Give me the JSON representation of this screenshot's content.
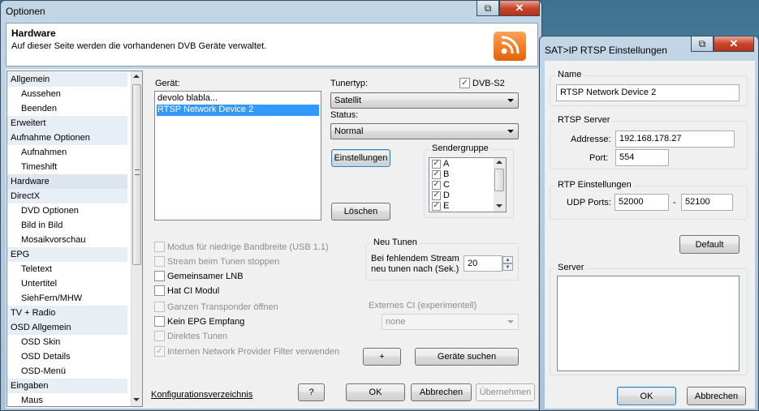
{
  "main_window": {
    "title": "Optionen",
    "header_title": "Hardware",
    "header_subtitle": "Auf dieser Seite werden die vorhandenen DVB Geräte verwaltet.",
    "accent_color": "#f47920"
  },
  "tree": [
    {
      "label": "Allgemein",
      "type": "cat"
    },
    {
      "label": "Aussehen",
      "type": "sub"
    },
    {
      "label": "Beenden",
      "type": "sub"
    },
    {
      "label": "Erweitert",
      "type": "cat"
    },
    {
      "label": "Aufnahme Optionen",
      "type": "cat"
    },
    {
      "label": "Aufnahmen",
      "type": "sub"
    },
    {
      "label": "Timeshift",
      "type": "sub"
    },
    {
      "label": "Hardware",
      "type": "cat",
      "selected": true
    },
    {
      "label": "DirectX",
      "type": "cat"
    },
    {
      "label": "DVD Optionen",
      "type": "sub"
    },
    {
      "label": "Bild in Bild",
      "type": "sub"
    },
    {
      "label": "Mosaikvorschau",
      "type": "sub"
    },
    {
      "label": "EPG",
      "type": "cat"
    },
    {
      "label": "Teletext",
      "type": "sub"
    },
    {
      "label": "Untertitel",
      "type": "sub"
    },
    {
      "label": "SiehFern/MHW",
      "type": "sub"
    },
    {
      "label": "TV + Radio",
      "type": "cat"
    },
    {
      "label": "OSD Allgemein",
      "type": "cat"
    },
    {
      "label": "OSD Skin",
      "type": "sub"
    },
    {
      "label": "OSD Details",
      "type": "sub"
    },
    {
      "label": "OSD-Menü",
      "type": "sub"
    },
    {
      "label": "Eingaben",
      "type": "cat"
    },
    {
      "label": "Maus",
      "type": "sub"
    }
  ],
  "hardware": {
    "device_label": "Gerät:",
    "devices": [
      "devolo blabla...",
      "RTSP Network Device 2"
    ],
    "selected_device": "RTSP Network Device 2",
    "tunertype_label": "Tunertyp:",
    "tunertype_value": "Satellit",
    "dvbs2_label": "DVB-S2",
    "dvbs2_checked": true,
    "status_label": "Status:",
    "status_value": "Normal",
    "einstellungen_btn": "Einstellungen",
    "loeschen_btn": "Löschen",
    "sendergruppe_label": "Sendergruppe",
    "sendergruppen": [
      "A",
      "B",
      "C",
      "D",
      "E"
    ],
    "options": [
      {
        "label": "Modus für niedrige Bandbreite (USB 1.1)",
        "checked": false,
        "enabled": false
      },
      {
        "label": "Stream beim Tunen stoppen",
        "checked": false,
        "enabled": false
      },
      {
        "label": "Gemeinsamer LNB",
        "checked": false,
        "enabled": true
      },
      {
        "label": "Hat CI Modul",
        "checked": false,
        "enabled": true
      },
      {
        "label": "Ganzen Transponder öffnen",
        "checked": false,
        "enabled": false
      },
      {
        "label": "Kein EPG Empfang",
        "checked": false,
        "enabled": true
      },
      {
        "label": "Direktes Tunen",
        "checked": false,
        "enabled": false
      },
      {
        "label": "Internen Network Provider Filter verwenden",
        "checked": true,
        "enabled": false
      }
    ],
    "neu_tunen_label": "Neu Tunen",
    "neu_tunen_text_1": "Bei fehlendem Stream",
    "neu_tunen_text_2": "neu tunen nach (Sek.)",
    "neu_tunen_value": "20",
    "externes_ci_label": "Externes CI (experimentell)",
    "externes_ci_value": "none",
    "plus_btn": "+",
    "geraete_suchen_btn": "Geräte suchen",
    "konfig_link": "Konfigurationsverzeichnis",
    "help_btn": "?",
    "ok_btn": "OK",
    "abbrechen_btn": "Abbrechen",
    "uebernehmen_btn": "Übernehmen"
  },
  "rtsp_window": {
    "title": "SAT>IP RTSP Einstellungen",
    "name_group": "Name",
    "name_value": "RTSP Network Device 2",
    "server_group": "RTSP Server",
    "address_label": "Addresse:",
    "address_value": "192.168.178.27",
    "port_label": "Port:",
    "port_value": "554",
    "rtp_group": "RTP Einstellungen",
    "udp_label": "UDP Ports:",
    "udp_from": "52000",
    "udp_sep": "-",
    "udp_to": "52100",
    "default_btn": "Default",
    "server_list_group": "Server",
    "ok_btn": "OK",
    "abbrechen_btn": "Abbrechen"
  }
}
